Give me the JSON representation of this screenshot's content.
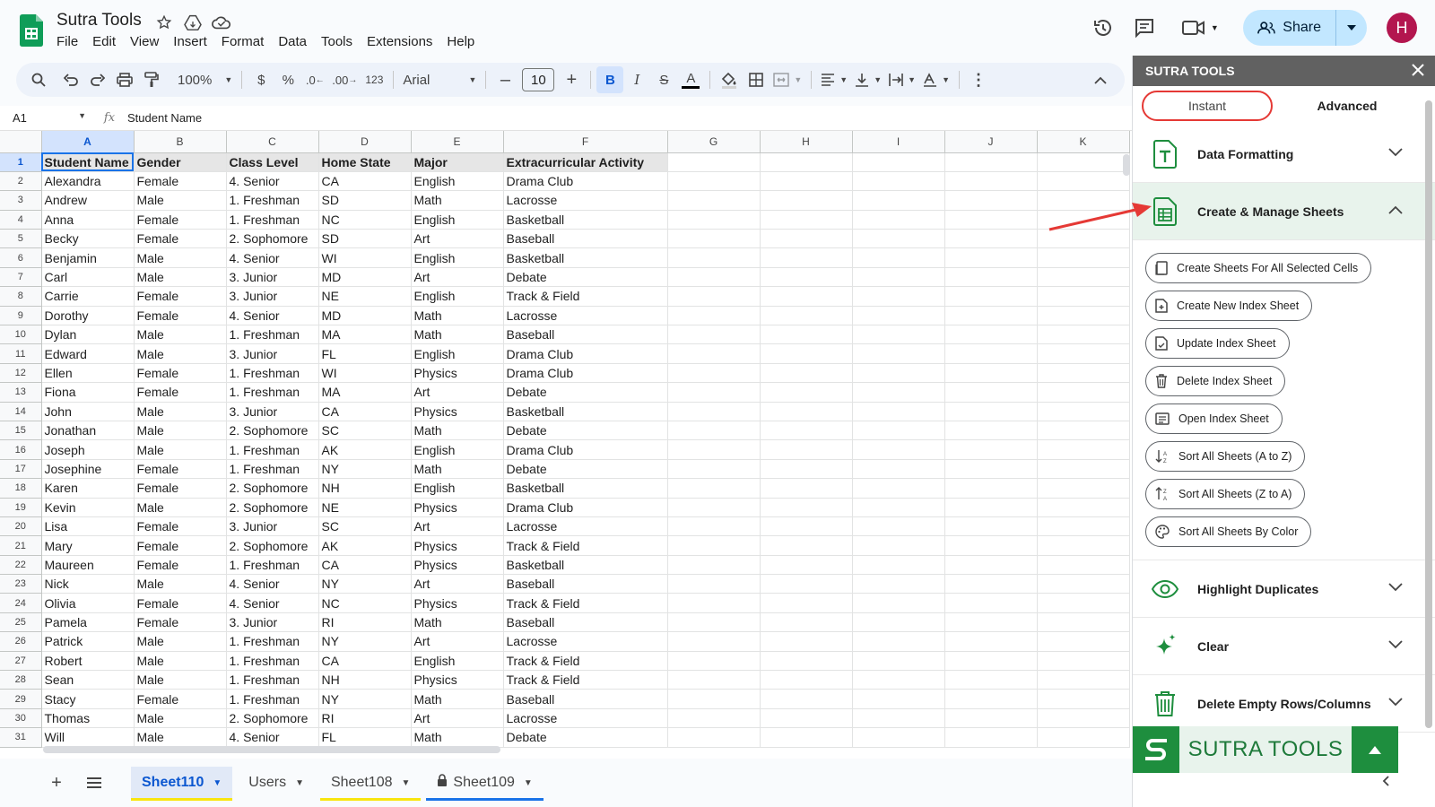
{
  "doc": {
    "title": "Sutra Tools",
    "menus": [
      "File",
      "Edit",
      "View",
      "Insert",
      "Format",
      "Data",
      "Tools",
      "Extensions",
      "Help"
    ]
  },
  "header": {
    "share_label": "Share",
    "avatar_letter": "H"
  },
  "toolbar": {
    "zoom": "100%",
    "currency": "$",
    "percent": "%",
    "decrease_decimal": ".0",
    "increase_decimal": ".00",
    "number_format": "123",
    "font": "Arial",
    "font_size": "10",
    "bold": "B",
    "italic": "I",
    "strike": "S",
    "text_color": "A"
  },
  "formula": {
    "cell_ref": "A1",
    "fx": "fx",
    "content": "Student Name"
  },
  "grid": {
    "columns": [
      "A",
      "B",
      "C",
      "D",
      "E",
      "F",
      "G",
      "H",
      "I",
      "J",
      "K"
    ],
    "header_row": [
      "Student Name",
      "Gender",
      "Class Level",
      "Home State",
      "Major",
      "Extracurricular Activity"
    ],
    "rows": [
      [
        "Alexandra",
        "Female",
        "4. Senior",
        "CA",
        "English",
        "Drama Club"
      ],
      [
        "Andrew",
        "Male",
        "1. Freshman",
        "SD",
        "Math",
        "Lacrosse"
      ],
      [
        "Anna",
        "Female",
        "1. Freshman",
        "NC",
        "English",
        "Basketball"
      ],
      [
        "Becky",
        "Female",
        "2. Sophomore",
        "SD",
        "Art",
        "Baseball"
      ],
      [
        "Benjamin",
        "Male",
        "4. Senior",
        "WI",
        "English",
        "Basketball"
      ],
      [
        "Carl",
        "Male",
        "3. Junior",
        "MD",
        "Art",
        "Debate"
      ],
      [
        "Carrie",
        "Female",
        "3. Junior",
        "NE",
        "English",
        "Track & Field"
      ],
      [
        "Dorothy",
        "Female",
        "4. Senior",
        "MD",
        "Math",
        "Lacrosse"
      ],
      [
        "Dylan",
        "Male",
        "1. Freshman",
        "MA",
        "Math",
        "Baseball"
      ],
      [
        "Edward",
        "Male",
        "3. Junior",
        "FL",
        "English",
        "Drama Club"
      ],
      [
        "Ellen",
        "Female",
        "1. Freshman",
        "WI",
        "Physics",
        "Drama Club"
      ],
      [
        "Fiona",
        "Female",
        "1. Freshman",
        "MA",
        "Art",
        "Debate"
      ],
      [
        "John",
        "Male",
        "3. Junior",
        "CA",
        "Physics",
        "Basketball"
      ],
      [
        "Jonathan",
        "Male",
        "2. Sophomore",
        "SC",
        "Math",
        "Debate"
      ],
      [
        "Joseph",
        "Male",
        "1. Freshman",
        "AK",
        "English",
        "Drama Club"
      ],
      [
        "Josephine",
        "Female",
        "1. Freshman",
        "NY",
        "Math",
        "Debate"
      ],
      [
        "Karen",
        "Female",
        "2. Sophomore",
        "NH",
        "English",
        "Basketball"
      ],
      [
        "Kevin",
        "Male",
        "2. Sophomore",
        "NE",
        "Physics",
        "Drama Club"
      ],
      [
        "Lisa",
        "Female",
        "3. Junior",
        "SC",
        "Art",
        "Lacrosse"
      ],
      [
        "Mary",
        "Female",
        "2. Sophomore",
        "AK",
        "Physics",
        "Track & Field"
      ],
      [
        "Maureen",
        "Female",
        "1. Freshman",
        "CA",
        "Physics",
        "Basketball"
      ],
      [
        "Nick",
        "Male",
        "4. Senior",
        "NY",
        "Art",
        "Baseball"
      ],
      [
        "Olivia",
        "Female",
        "4. Senior",
        "NC",
        "Physics",
        "Track & Field"
      ],
      [
        "Pamela",
        "Female",
        "3. Junior",
        "RI",
        "Math",
        "Baseball"
      ],
      [
        "Patrick",
        "Male",
        "1. Freshman",
        "NY",
        "Art",
        "Lacrosse"
      ],
      [
        "Robert",
        "Male",
        "1. Freshman",
        "CA",
        "English",
        "Track & Field"
      ],
      [
        "Sean",
        "Male",
        "1. Freshman",
        "NH",
        "Physics",
        "Track & Field"
      ],
      [
        "Stacy",
        "Female",
        "1. Freshman",
        "NY",
        "Math",
        "Baseball"
      ],
      [
        "Thomas",
        "Male",
        "2. Sophomore",
        "RI",
        "Art",
        "Lacrosse"
      ],
      [
        "Will",
        "Male",
        "4. Senior",
        "FL",
        "Math",
        "Debate"
      ]
    ]
  },
  "sheets": [
    {
      "name": "Sheet110",
      "active": true,
      "color": "#f9e50e",
      "locked": false
    },
    {
      "name": "Users",
      "active": false,
      "color": "",
      "locked": false
    },
    {
      "name": "Sheet108",
      "active": false,
      "color": "#f9e50e",
      "locked": false
    },
    {
      "name": "Sheet109",
      "active": false,
      "color": "#1a73e8",
      "locked": true
    }
  ],
  "panel": {
    "title": "SUTRA TOOLS",
    "tabs": {
      "instant": "Instant",
      "advanced": "Advanced"
    },
    "sections": {
      "data_formatting": "Data Formatting",
      "create_manage": "Create & Manage Sheets",
      "highlight": "Highlight Duplicates",
      "clear": "Clear",
      "delete_empty": "Delete Empty Rows/Columns"
    },
    "actions": [
      "Create Sheets For All Selected Cells",
      "Create New Index Sheet",
      "Update Index Sheet",
      "Delete Index Sheet",
      "Open Index Sheet",
      "Sort All Sheets (A to Z)",
      "Sort All Sheets (Z to A)",
      "Sort All Sheets By Color"
    ],
    "footer_text": "SUTRA TOOLS"
  },
  "colors": {
    "accent_green": "#1e8e3e",
    "share_bg": "#c2e7ff",
    "avatar_bg": "#b3164f",
    "highlight_red": "#e53935"
  }
}
